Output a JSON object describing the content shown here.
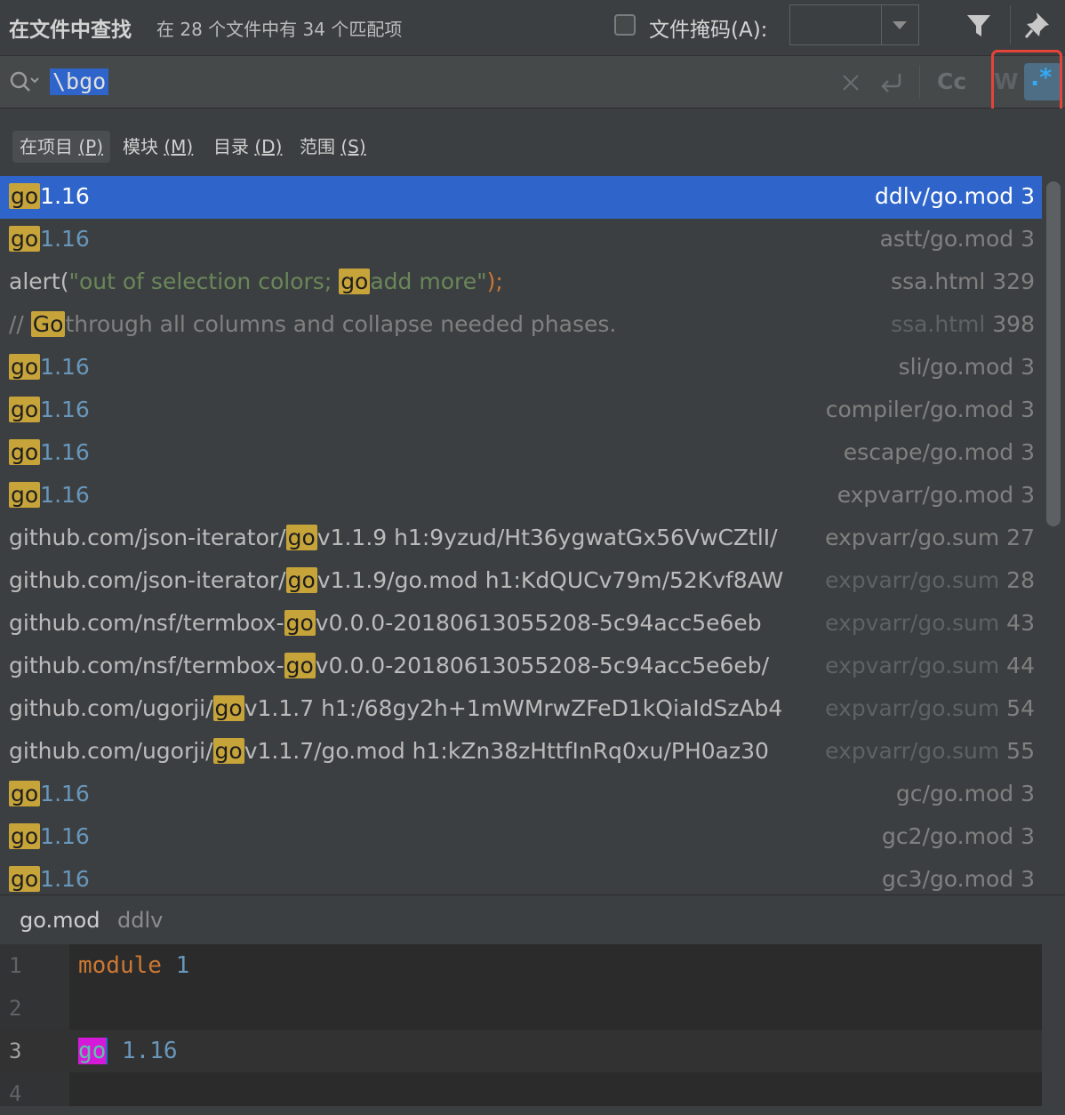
{
  "header": {
    "title": "在文件中查找",
    "summary": "在 28 个文件中有 34 个匹配项",
    "file_mask_label": "文件掩码(A):",
    "file_mask_value": ""
  },
  "search": {
    "query": "\\bgo",
    "case_label": "Cc",
    "words_label": "W",
    "regex_label": ".*"
  },
  "scopes": [
    {
      "label": "在项目",
      "key": "(P)"
    },
    {
      "label": "模块",
      "key": "(M)"
    },
    {
      "label": "目录",
      "key": "(D)"
    },
    {
      "label": "范围",
      "key": "(S)"
    }
  ],
  "results": [
    {
      "pre": "",
      "match": "go",
      "post": "1.16",
      "kind": "num",
      "file": "ddlv/go.mod",
      "line": "3"
    },
    {
      "pre": "",
      "match": "go",
      "post": "1.16",
      "kind": "num",
      "file": "astt/go.mod",
      "line": "3"
    },
    {
      "pre": "alert(",
      "match": "go",
      "post": "add more\");",
      "kind": "str",
      "pre_str": "\"out of selection colors; ",
      "file": "ssa.html",
      "line": "329"
    },
    {
      "pre": "// ",
      "match": "Go",
      "post": "through all columns and collapse needed phases.",
      "kind": "cmt",
      "file": "ssa.html",
      "line": "398"
    },
    {
      "pre": "",
      "match": "go",
      "post": "1.16",
      "kind": "num",
      "file": "sli/go.mod",
      "line": "3"
    },
    {
      "pre": "",
      "match": "go",
      "post": "1.16",
      "kind": "num",
      "file": "compiler/go.mod",
      "line": "3"
    },
    {
      "pre": "",
      "match": "go",
      "post": "1.16",
      "kind": "num",
      "file": "escape/go.mod",
      "line": "3"
    },
    {
      "pre": "",
      "match": "go",
      "post": "1.16",
      "kind": "num",
      "file": "expvarr/go.mod",
      "line": "3"
    },
    {
      "pre": "github.com/json-iterator/",
      "match": "go",
      "post": "v1.1.9 h1:9yzud/Ht36ygwatGx56VwCZtlI/",
      "kind": "plain",
      "file": "expvarr/go.sum",
      "line": "27"
    },
    {
      "pre": "github.com/json-iterator/",
      "match": "go",
      "post": "v1.1.9/go.mod h1:KdQUCv79m/52Kvf8AW",
      "kind": "plain",
      "file": "expvarr/go.sum",
      "line": "28"
    },
    {
      "pre": "github.com/nsf/termbox-",
      "match": "go",
      "post": "v0.0.0-20180613055208-5c94acc5e6eb",
      "kind": "plain",
      "file": "expvarr/go.sum",
      "line": "43"
    },
    {
      "pre": "github.com/nsf/termbox-",
      "match": "go",
      "post": "v0.0.0-20180613055208-5c94acc5e6eb/",
      "kind": "plain",
      "file": "expvarr/go.sum",
      "line": "44"
    },
    {
      "pre": "github.com/ugorji/",
      "match": "go",
      "post": "v1.1.7 h1:/68gy2h+1mWMrwZFeD1kQiaIdSzAb4",
      "kind": "plain",
      "file": "expvarr/go.sum",
      "line": "54"
    },
    {
      "pre": "github.com/ugorji/",
      "match": "go",
      "post": "v1.1.7/go.mod h1:kZn38zHttfInRq0xu/PH0az30",
      "kind": "plain",
      "file": "expvarr/go.sum",
      "line": "55"
    },
    {
      "pre": "",
      "match": "go",
      "post": "1.16",
      "kind": "num",
      "file": "gc/go.mod",
      "line": "3"
    },
    {
      "pre": "",
      "match": "go",
      "post": "1.16",
      "kind": "num",
      "file": "gc2/go.mod",
      "line": "3"
    },
    {
      "pre": "",
      "match": "go",
      "post": "1.16",
      "kind": "num",
      "file": "gc3/go.mod",
      "line": "3"
    }
  ],
  "preview": {
    "file": "go.mod",
    "dir": "ddlv",
    "lines": [
      {
        "n": "1",
        "kw": "module",
        "rest": "1"
      },
      {
        "n": "2",
        "kw": "",
        "rest": ""
      },
      {
        "n": "3",
        "kw": "go",
        "rest": "1.16"
      },
      {
        "n": "4",
        "kw": "",
        "rest": ""
      }
    ]
  }
}
